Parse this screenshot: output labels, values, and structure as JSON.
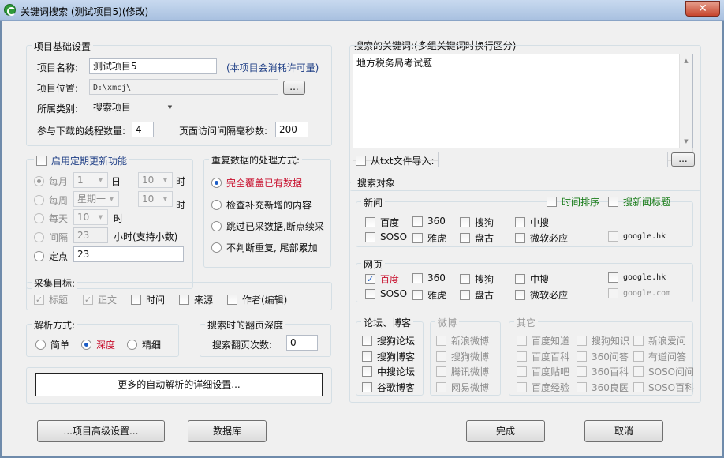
{
  "window": {
    "title": "关键词搜索 (测试项目5)(修改)",
    "close_glyph": "✕"
  },
  "basic": {
    "legend": "项目基础设置",
    "name_label": "项目名称:",
    "name_value": "测试项目5",
    "license_note": "(本项目会消耗许可量)",
    "location_label": "项目位置:",
    "location_value": "D:\\xmcj\\",
    "browse_label": "...",
    "category_label": "所属类别:",
    "category_value": "搜索项目",
    "threads_label": "参与下载的线程数量:",
    "threads_value": "4",
    "interval_label": "页面访问间隔毫秒数:",
    "interval_value": "200"
  },
  "schedule": {
    "enable_label": "启用定期更新功能",
    "monthly": {
      "label": "每月",
      "day_value": "1",
      "day_unit": "日",
      "hour_value": "10",
      "hour_unit": "时"
    },
    "weekly": {
      "label": "每周",
      "weekday_value": "星期一",
      "hour_value": "10",
      "hour_unit": "时"
    },
    "daily": {
      "label": "每天",
      "hour_value": "10",
      "hour_unit": "时"
    },
    "interval": {
      "label": "间隔",
      "value": "23",
      "unit": "小时(支持小数)"
    },
    "fixed": {
      "label": "定点",
      "value": "23"
    }
  },
  "duplicate": {
    "legend": "重复数据的处理方式:",
    "options": [
      "完全覆盖已有数据",
      "检查补充新增的内容",
      "跳过已采数据,断点续采",
      "不判断重复, 尾部累加"
    ],
    "selected": 0
  },
  "targets": {
    "legend": "采集目标:",
    "items": [
      {
        "label": "标题",
        "checked": true,
        "disabled": true
      },
      {
        "label": "正文",
        "checked": true,
        "disabled": true
      },
      {
        "label": "时间",
        "checked": false,
        "disabled": false
      },
      {
        "label": "来源",
        "checked": false,
        "disabled": false
      },
      {
        "label": "作者(编辑)",
        "checked": false,
        "disabled": false
      }
    ]
  },
  "parse": {
    "legend": "解析方式:",
    "options": [
      "简单",
      "深度",
      "精细"
    ],
    "selected": 1
  },
  "paging": {
    "legend": "搜索时的翻页深度",
    "label": "搜索翻页次数:",
    "value": "0"
  },
  "more_parse_button": "更多的自动解析的详细设置...",
  "keywords": {
    "legend": "搜索的关键词:(多组关键词时换行区分)",
    "text": "地方税务局考试题",
    "import_label": "从txt文件导入:",
    "import_browse": "..."
  },
  "search_targets": {
    "legend": "搜索对象",
    "news": {
      "legend": "新闻",
      "time_sort": "时间排序",
      "search_news_title": "搜新闻标题",
      "engines": [
        {
          "label": "百度",
          "checked": false
        },
        {
          "label": "360",
          "checked": false
        },
        {
          "label": "搜狗",
          "checked": false
        },
        {
          "label": "中搜",
          "checked": false
        },
        {
          "label": "SOSO",
          "checked": false
        },
        {
          "label": "雅虎",
          "checked": false
        },
        {
          "label": "盘古",
          "checked": false
        },
        {
          "label": "微软必应",
          "checked": false
        }
      ],
      "google": "google.hk"
    },
    "web": {
      "legend": "网页",
      "engines": [
        {
          "label": "百度",
          "checked": true
        },
        {
          "label": "360",
          "checked": false
        },
        {
          "label": "搜狗",
          "checked": false
        },
        {
          "label": "中搜",
          "checked": false
        },
        {
          "label": "SOSO",
          "checked": false
        },
        {
          "label": "雅虎",
          "checked": false
        },
        {
          "label": "盘古",
          "checked": false
        },
        {
          "label": "微软必应",
          "checked": false
        }
      ],
      "google_hk": "google.hk",
      "google_com": "google.com"
    },
    "forum": {
      "legend": "论坛、博客",
      "items": [
        "搜狗论坛",
        "搜狗博客",
        "中搜论坛",
        "谷歌博客"
      ]
    },
    "weibo": {
      "legend": "微博",
      "items": [
        "新浪微博",
        "搜狗微博",
        "腾讯微博",
        "网易微博"
      ]
    },
    "other": {
      "legend": "其它",
      "items": [
        "百度知道",
        "搜狗知识",
        "新浪爱问",
        "百度百科",
        "360问答",
        "有道问答",
        "百度贴吧",
        "360百科",
        "SOSO问问",
        "百度经验",
        "360良医",
        "SOSO百科"
      ]
    }
  },
  "footer": {
    "advanced": "...项目高级设置...",
    "database": "数据库",
    "finish": "完成",
    "cancel": "取消"
  },
  "colors": {
    "accent_red": "#c8102e",
    "accent_green": "#1a7d1a",
    "legend_blue": "#1f3f86"
  }
}
